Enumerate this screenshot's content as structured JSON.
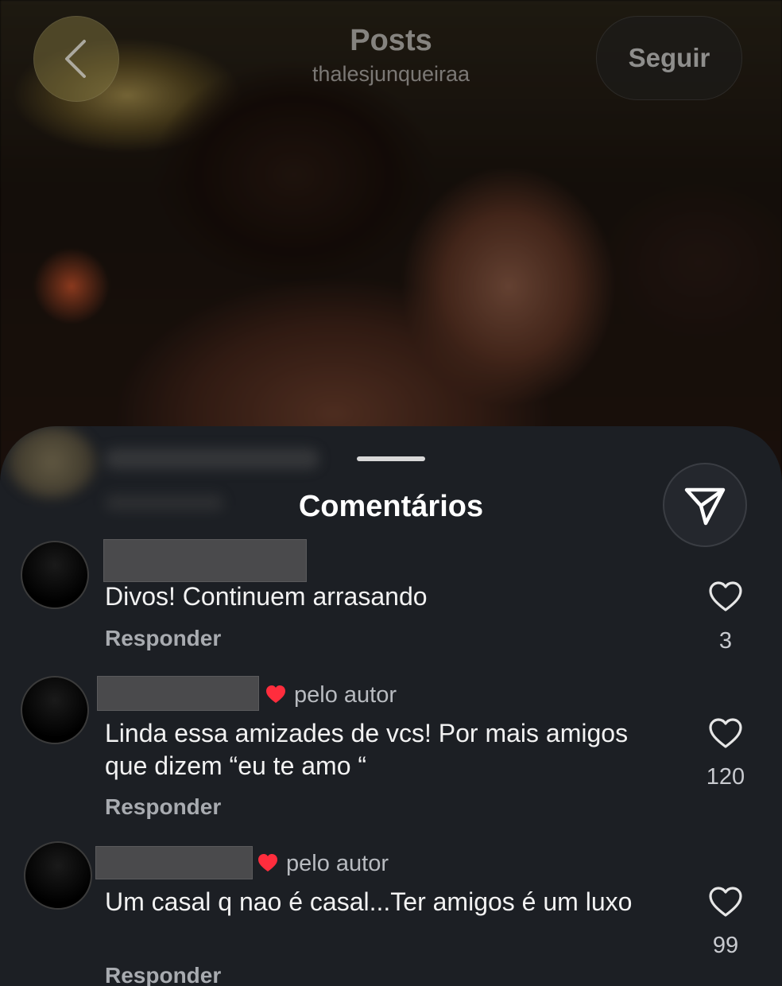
{
  "header": {
    "title": "Posts",
    "username": "thalesjunqueiraa",
    "follow_label": "Seguir"
  },
  "sheet": {
    "title": "Comentários"
  },
  "comments": [
    {
      "text": "Divos! Continuem arrasando",
      "reply_label": "Responder",
      "likes": "3",
      "liked_by_author": false,
      "author_badge": ""
    },
    {
      "text": "Linda essa amizades de vcs! Por mais amigos que dizem “eu te amo “",
      "reply_label": "Responder",
      "likes": "120",
      "liked_by_author": true,
      "author_badge": "pelo autor"
    },
    {
      "text": "Um casal q nao é casal...Ter amigos é um luxo",
      "reply_label": "Responder",
      "likes": "99",
      "liked_by_author": true,
      "author_badge": "pelo autor"
    }
  ],
  "icons": {
    "back": "chevron-left-icon",
    "share": "send-icon",
    "like": "heart-outline-icon",
    "author_like": "heart-filled-icon"
  },
  "colors": {
    "sheet_bg": "#1c1f24",
    "author_heart": "#ff2d3d",
    "text": "#f2f2f2",
    "muted": "#a8abb0"
  }
}
